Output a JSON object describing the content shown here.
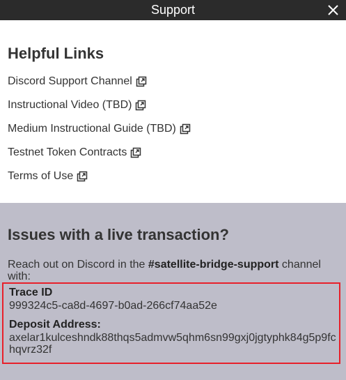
{
  "window": {
    "title": "Support"
  },
  "helpful_links": {
    "heading": "Helpful Links",
    "items": [
      {
        "label": "Discord Support Channel"
      },
      {
        "label": "Instructional Video (TBD)"
      },
      {
        "label": "Medium Instructional Guide (TBD)"
      },
      {
        "label": "Testnet Token Contracts"
      },
      {
        "label": "Terms of Use"
      }
    ]
  },
  "issues": {
    "heading": "Issues with a live transaction?",
    "reach_prefix": "Reach out on Discord in the ",
    "channel": "#satellite-bridge-support",
    "reach_suffix": " channel with:",
    "trace_id_label": "Trace ID",
    "trace_id_value": "999324c5-ca8d-4697-b0ad-266cf74aa52e",
    "deposit_label": "Deposit Address:",
    "deposit_value_line1": "axelar1kulceshndk88thqs5admvw5qhm6sn99gxj0jgtyphk84g5p9fc",
    "deposit_value_line2": "hqvrz32f"
  },
  "colors": {
    "titlebar": "#2b2b2b",
    "issues_background": "#bebdc9",
    "highlight_border": "#e8202a"
  }
}
